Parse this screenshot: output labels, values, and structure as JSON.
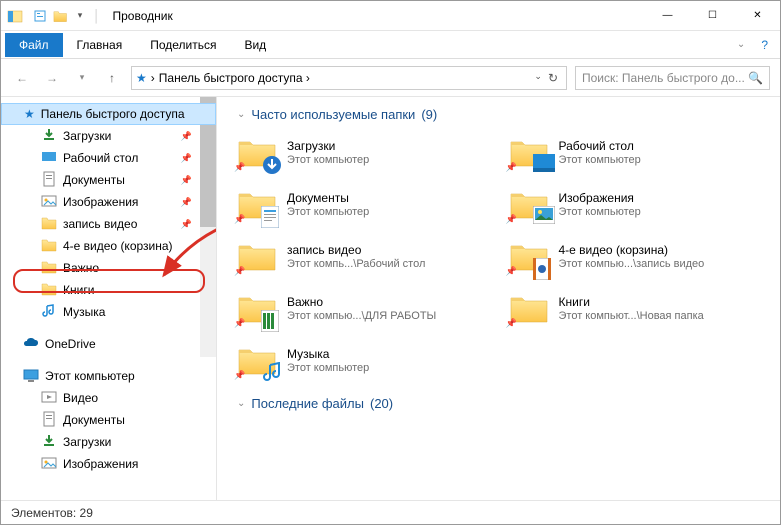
{
  "window": {
    "title": "Проводник",
    "min": "—",
    "max": "☐",
    "close": "✕"
  },
  "ribbon": {
    "file": "Файл",
    "home": "Главная",
    "share": "Поделиться",
    "view": "Вид",
    "help": "?"
  },
  "address": {
    "text": "Панель быстрого доступа ›",
    "chevron": "›"
  },
  "search": {
    "placeholder": "Поиск: Панель быстрого до..."
  },
  "tree": {
    "quick": "Панель быстрого доступа",
    "items": [
      "Загрузки",
      "Рабочий стол",
      "Документы",
      "Изображения",
      "запись видео",
      "4-е видео (корзина)",
      "Важно",
      "Книги",
      "Музыка"
    ],
    "onedrive": "OneDrive",
    "thispc": "Этот компьютер",
    "pc_items": [
      "Видео",
      "Документы",
      "Загрузки",
      "Изображения"
    ]
  },
  "sections": {
    "freq": {
      "title": "Часто используемые папки",
      "count": "(9)"
    },
    "recent": {
      "title": "Последние файлы",
      "count": "(20)"
    }
  },
  "folders": [
    {
      "name": "Загрузки",
      "sub": "Этот компьютер",
      "ov": "down"
    },
    {
      "name": "Рабочий стол",
      "sub": "Этот компьютер",
      "ov": "desk"
    },
    {
      "name": "Документы",
      "sub": "Этот компьютер",
      "ov": "doc"
    },
    {
      "name": "Изображения",
      "sub": "Этот компьютер",
      "ov": "pic"
    },
    {
      "name": "запись видео",
      "sub": "Этот компь...\\Рабочий стол",
      "ov": "none"
    },
    {
      "name": "4-е видео (корзина)",
      "sub": "Этот компью...\\запись видео",
      "ov": "vid"
    },
    {
      "name": "Важно",
      "sub": "Этот компью...\\ДЛЯ РАБОТЫ",
      "ov": "xls"
    },
    {
      "name": "Книги",
      "sub": "Этот компьют...\\Новая папка",
      "ov": "none"
    },
    {
      "name": "Музыка",
      "sub": "Этот компьютер",
      "ov": "mus"
    }
  ],
  "status": {
    "label": "Элементов:",
    "count": "29"
  }
}
